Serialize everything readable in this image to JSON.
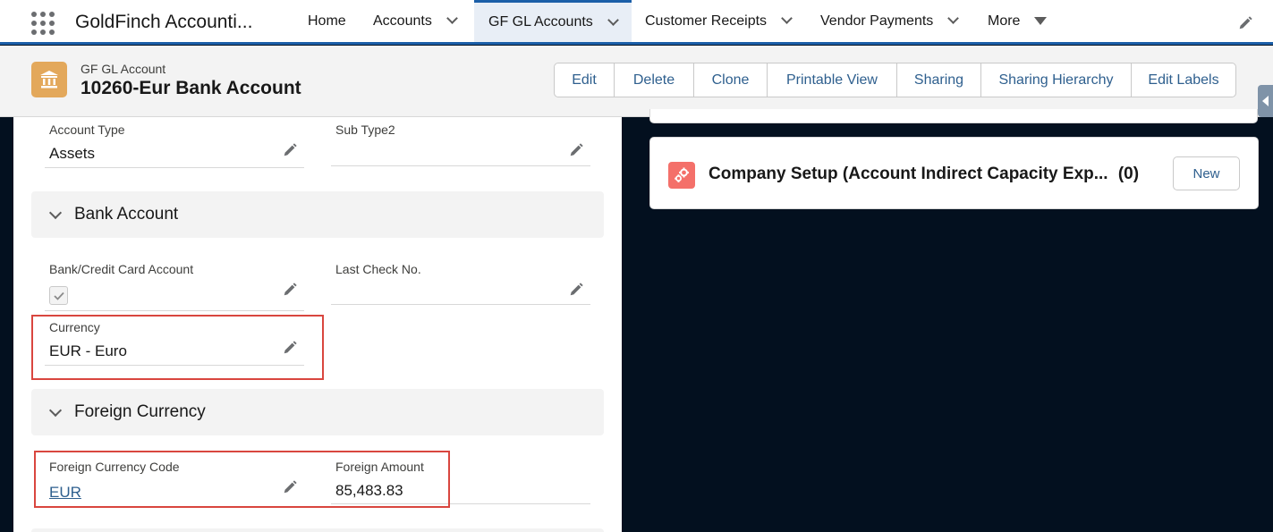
{
  "app": {
    "name": "GoldFinch Accounti..."
  },
  "nav": {
    "items": [
      {
        "label": "Home"
      },
      {
        "label": "Accounts"
      },
      {
        "label": "GF GL Accounts"
      },
      {
        "label": "Customer Receipts"
      },
      {
        "label": "Vendor Payments"
      },
      {
        "label": "More"
      }
    ]
  },
  "record": {
    "object_label": "GF GL Account",
    "title": "10260-Eur Bank Account",
    "icon": "bank-icon",
    "actions": [
      "Edit",
      "Delete",
      "Clone",
      "Printable View",
      "Sharing",
      "Sharing Hierarchy",
      "Edit Labels"
    ]
  },
  "fields": {
    "account_type": {
      "label": "Account Type",
      "value": "Assets"
    },
    "sub_type2": {
      "label": "Sub Type2",
      "value": ""
    },
    "bank_credit_card": {
      "label": "Bank/Credit Card Account",
      "checked": true
    },
    "last_check_no": {
      "label": "Last Check No.",
      "value": ""
    },
    "currency": {
      "label": "Currency",
      "value": "EUR - Euro"
    },
    "foreign_currency_code": {
      "label": "Foreign Currency Code",
      "value": "EUR"
    },
    "foreign_amount": {
      "label": "Foreign Amount",
      "value": "85,483.83"
    }
  },
  "sections": {
    "bank_account": {
      "label": "Bank Account"
    },
    "foreign_currency": {
      "label": "Foreign Currency"
    }
  },
  "related": {
    "title": "Company Setup (Account Indirect Capacity Exp...",
    "count": "(0)",
    "new_label": "New",
    "icon": "gears-icon"
  },
  "colors": {
    "brand_blue": "#1b5fa8",
    "link_blue": "#2e5f8e",
    "highlight_red": "#d9463f",
    "record_icon": "#e3a85b",
    "related_icon": "#f4706a",
    "background_dark": "#03101f"
  }
}
